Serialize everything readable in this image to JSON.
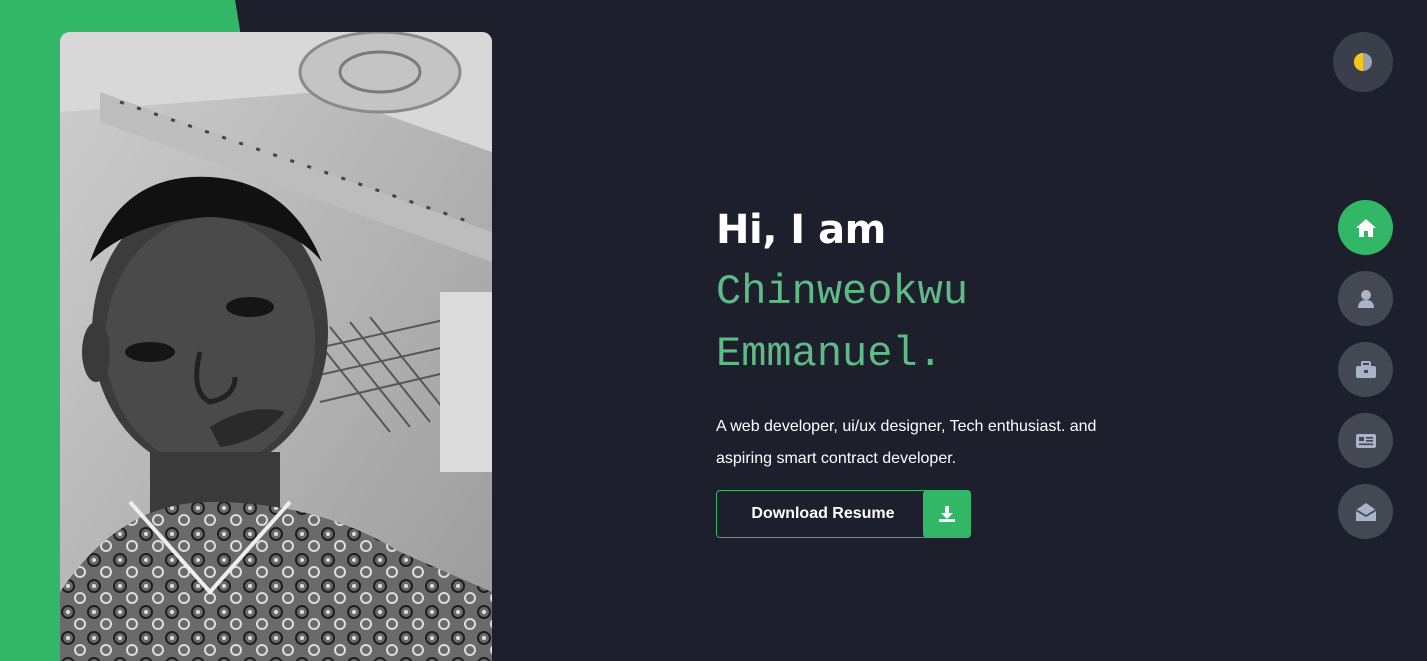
{
  "hero": {
    "greeting": "Hi, I am",
    "name_line1": "Chinweokwu",
    "name_line2": "Emmanuel.",
    "bio": "A web developer, ui/ux designer, Tech enthusiast. and aspiring smart contract developer.",
    "resume_button_label": "Download Resume"
  },
  "photo": {
    "alt": "Portrait photo"
  },
  "theme_toggle": {
    "icon": "half-circle-icon"
  },
  "nav": {
    "items": [
      {
        "icon": "home-icon",
        "active": true
      },
      {
        "icon": "user-icon",
        "active": false
      },
      {
        "icon": "briefcase-icon",
        "active": false
      },
      {
        "icon": "newspaper-icon",
        "active": false
      },
      {
        "icon": "envelope-open-icon",
        "active": false
      }
    ]
  },
  "colors": {
    "background": "#1d1f2c",
    "accent": "#31b765",
    "name_text": "#5fba86",
    "nav_button": "#434853",
    "theme_toggle_bg": "#3a3f4b",
    "theme_icon_yellow": "#f5c518"
  }
}
